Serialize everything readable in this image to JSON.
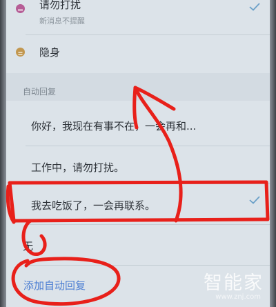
{
  "status_rows": [
    {
      "label": "请勿打扰",
      "subtitle": "新消息不提醒",
      "icon": "do-not-disturb-icon",
      "checked": true
    },
    {
      "label": "隐身",
      "icon": "invisible-icon",
      "checked": false
    }
  ],
  "auto_reply": {
    "header": "自动回复",
    "options": [
      {
        "label": "你好，我现在有事不在，一会再和..."
      },
      {
        "label": "工作中，请勿打扰。"
      },
      {
        "label": "我去吃饭了，一会再联系。",
        "selected": true
      },
      {
        "label": "无"
      }
    ],
    "add_label": "添加自动回复"
  },
  "watermark": {
    "text": "智能家",
    "url": "www.znj.com"
  },
  "colors": {
    "accent": "#4d7fd3",
    "check": "#6aa0c8",
    "annotation": "#e8201a"
  }
}
